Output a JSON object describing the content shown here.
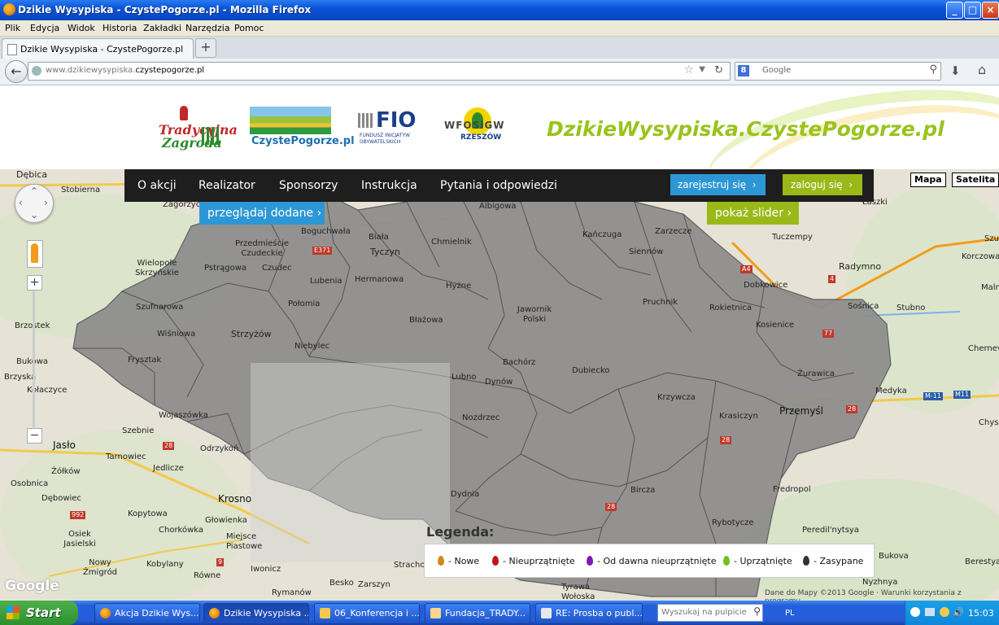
{
  "window": {
    "title": "Dzikie Wysypiska - CzystePogorze.pl - Mozilla Firefox",
    "controls": {
      "minimize": "_",
      "maximize": "□",
      "close": "×"
    }
  },
  "menu": [
    "Plik",
    "Edycja",
    "Widok",
    "Historia",
    "Zakładki",
    "Narzędzia",
    "Pomoc"
  ],
  "tab": {
    "label": "Dzikie Wysypiska - CzystePogorze.pl",
    "new_tab": "+"
  },
  "nav": {
    "url_prefix": "www.dzikiewysypiska.",
    "url_domain": "czystepogorze.pl",
    "search_placeholder": "Google",
    "search_engine_icon": "google-icon"
  },
  "header": {
    "logo1_line1": "Tradycyjna",
    "logo1_line2": "Zagroda",
    "logo2_text": "CzystePogorze.pl",
    "logo3_text": "FIO",
    "logo3_sub": "FUNDUSZ INICJATYW OBYWATELSKICH",
    "logo4_text": "WFOSiGW",
    "logo4_sub": "RZESZÓW",
    "site_title": "DzikieWysypiska.CzystePogorze.pl"
  },
  "site_nav": {
    "items": [
      "O akcji",
      "Realizator",
      "Sponsorzy",
      "Instrukcja",
      "Pytania i odpowiedzi"
    ],
    "register": "zarejestruj się",
    "login": "zaloguj się",
    "browse": "przeglądaj dodane",
    "slider": "pokaż slider",
    "arrow": "›"
  },
  "map": {
    "type_buttons": [
      "Mapa",
      "Satelita"
    ],
    "google": "Google",
    "copyright": "Dane do Mapy ©2013 Google · Warunki korzystania z programu",
    "places": [
      "Dębica",
      "Stobierna",
      "Zagorzyce",
      "Wielopole Skrzyńskie",
      "Szufnarowa",
      "Wiśniowa",
      "Frysztak",
      "Brzostek",
      "Bukowa",
      "Brzyska",
      "Kołaczyce",
      "Wojaszówka",
      "Jasło",
      "Szebnie",
      "Tarnowiec",
      "Jedlicze",
      "Żółków",
      "Osobnica",
      "Dębowiec",
      "Kopytowa",
      "Osiek Jasielski",
      "Chorkówka",
      "Nowy Żmigród",
      "Kobylany",
      "Równe",
      "Głowienka",
      "Krosno",
      "Odrzykoń",
      "Miejsce Piastowe",
      "Iwonicz",
      "Rymanów",
      "Besko",
      "Zarszyn",
      "Strachocina",
      "Tyrawa Wołoska",
      "Przedmieście Czudeckie",
      "Czudec",
      "Pstrągowa",
      "Strzyżów",
      "Niebylec",
      "Połomia",
      "Boguchwała",
      "Lubenia",
      "Tyczyn",
      "Hermanowa",
      "Biała",
      "Chmielnik",
      "Albigowa",
      "Kańczuga",
      "Zarzecze",
      "Siennów",
      "Hyżne",
      "Błażowa",
      "Jawornik Polski",
      "Pruchnik",
      "Rokietnica",
      "Kosienice",
      "Dobkowice",
      "Radymno",
      "Tuczempy",
      "Łaszki",
      "Korczowa",
      "Sośnica",
      "Stubno",
      "Bachórz",
      "Dubiecko",
      "Dynów",
      "Lubno",
      "Nozdrzec",
      "Krzywcza",
      "Krasiczyn",
      "Przemyśl",
      "Żurawica",
      "Medyka",
      "Cherneve",
      "Dydnia",
      "Bircza",
      "Fredropol",
      "Rybotycze",
      "Peredil'nytsya",
      "Bukova",
      "Nyzhnya",
      "Berestya",
      "Malnów",
      "Chyszky",
      "Szuszk"
    ]
  },
  "legend": {
    "title": "Legenda:",
    "items": [
      {
        "label": "- Nowe",
        "color": "#d08a1a"
      },
      {
        "label": "- Nieuprzątnięte",
        "color": "#c0141c"
      },
      {
        "label": "- Od dawna nieuprzątnięte",
        "color": "#7a1ab0"
      },
      {
        "label": "- Uprzątnięte",
        "color": "#6ec21a"
      },
      {
        "label": "- Zasypane",
        "color": "#333333"
      }
    ]
  },
  "taskbar": {
    "start": "Start",
    "tasks": [
      "Akcja Dzikie Wys...",
      "Dzikie Wysypiska ...",
      "06_Konferencja i ...",
      "Fundacja_TRADY...",
      "RE: Prosba o publ..."
    ],
    "search_placeholder": "Wyszukaj na pulpicie",
    "lang": "PL",
    "time": "15:03"
  },
  "colors": {
    "accent_blue": "#2d97d6",
    "accent_green": "#9ab918",
    "nav_dark": "#1e1e1e",
    "site_title": "#9ac31c"
  }
}
